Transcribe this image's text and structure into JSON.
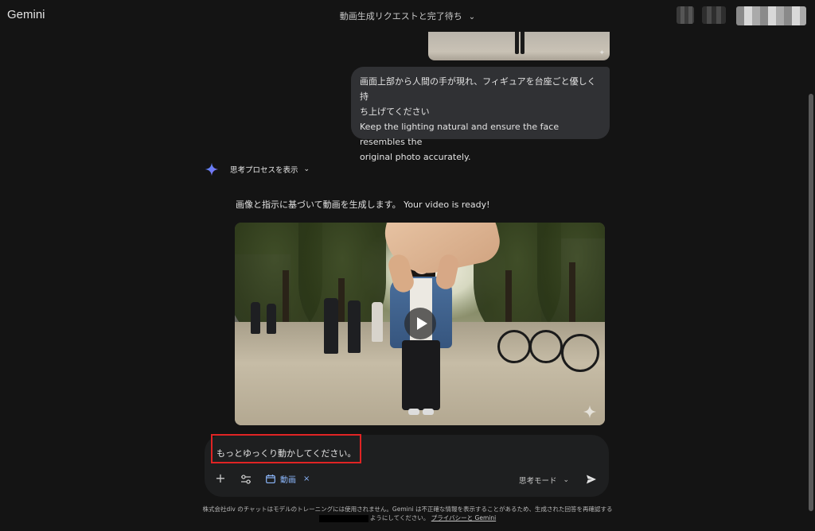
{
  "header": {
    "brand": "Gemini",
    "conversation_title": "動画生成リクエストと完了待ち",
    "title_chevron": "⌄"
  },
  "messages": {
    "user_prompt_line1": "画面上部から人間の手が現れ、フィギュアを台座ごと優しく持",
    "user_prompt_line2": "ち上げてください",
    "user_prompt_line3": "Keep the lighting natural and ensure the face resembles the",
    "user_prompt_line4": "original photo accurately.",
    "thought_toggle_label": "思考プロセスを表示",
    "thought_chevron": "⌄",
    "response_text": "画像と指示に基づいて動画を生成します。 Your video is ready!",
    "video": {
      "play_icon": "play-icon",
      "watermark_icon": "sparkle-icon"
    }
  },
  "composer": {
    "input_value": "もっとゆっくり動かしてください。",
    "plus_label": "+",
    "tools_icon": "tools-icon",
    "chip_label": "動画",
    "chip_close": "×",
    "mode_label": "思考モード",
    "mode_chevron": "⌄",
    "send_icon": "send-icon"
  },
  "footer": {
    "line1": "株式会社div のチャットはモデルのトレーニングには使用されません。Gemini は不正確な情報を表示することがあるため、生成された回答を再確認する",
    "line2": "ようにしてください。",
    "link": "プライバシーと Gemini"
  },
  "colors": {
    "background": "#141414",
    "bubble": "#303134",
    "composer": "#1e1f20",
    "accent": "#8ab4f8",
    "highlight": "#e02424"
  }
}
